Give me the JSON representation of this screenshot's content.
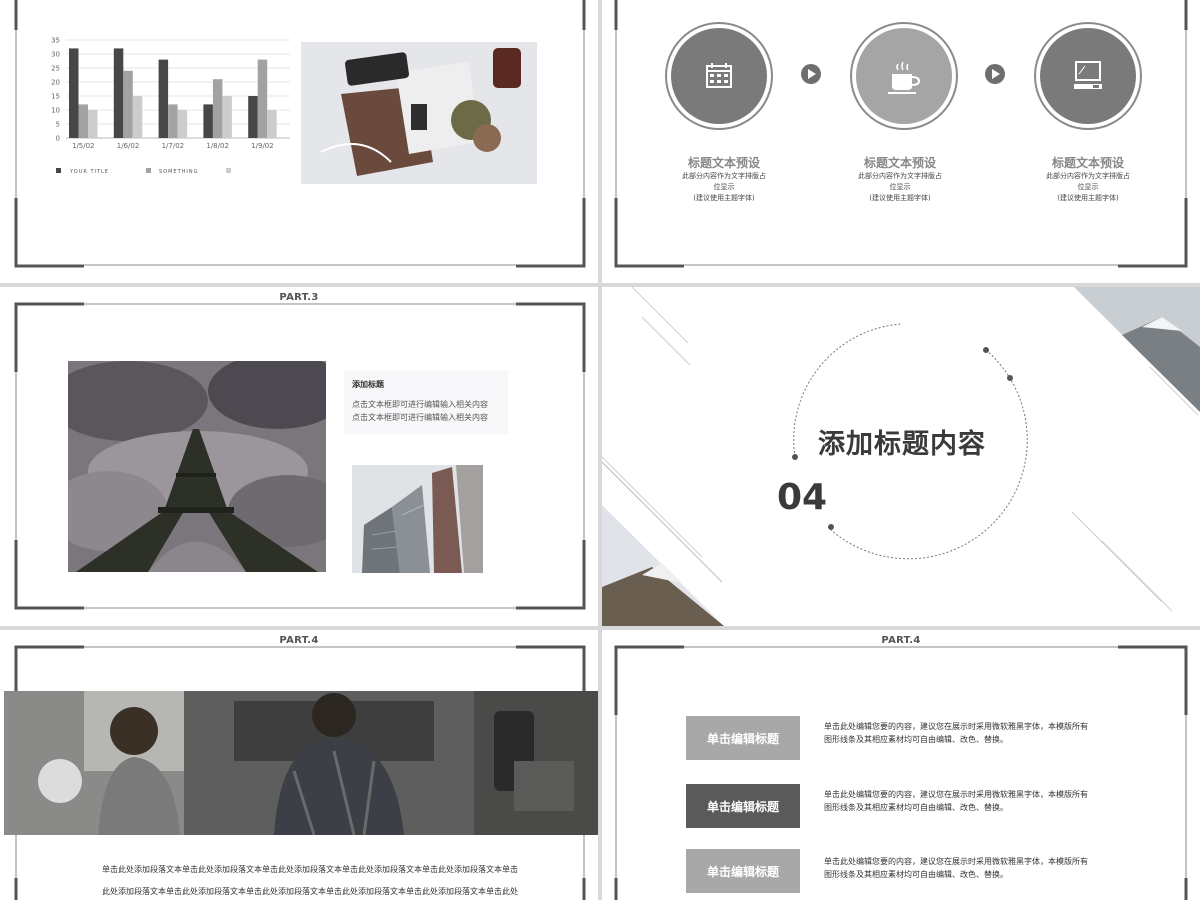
{
  "slide1": {
    "chart_data": {
      "type": "bar",
      "categories": [
        "1/5/02",
        "1/6/02",
        "1/7/02",
        "1/8/02",
        "1/9/02"
      ],
      "series": [
        {
          "name": "YOUR TITLE",
          "values": [
            32,
            32,
            28,
            12,
            15
          ],
          "color": "#474747"
        },
        {
          "name": "SOMETHING",
          "values": [
            12,
            24,
            12,
            21,
            28
          ],
          "color": "#a2a2a2"
        },
        {
          "values": [
            10,
            15,
            10,
            15,
            10
          ],
          "color": "#cccccc"
        }
      ],
      "yticks": [
        "0",
        "5",
        "10",
        "15",
        "20",
        "25",
        "30",
        "35"
      ],
      "ylim": [
        0,
        35
      ],
      "legend": "bottom-left",
      "grid": true
    },
    "legend": {
      "item1": "YOUR TITLE",
      "item2": "SOMETHING"
    },
    "photo_icon": "desk-flatlay-photo"
  },
  "slide2": {
    "steps": [
      {
        "icon": "calendar-icon",
        "title": "标题文本预设",
        "desc1": "此部分内容作为文字排版占",
        "desc2": "位显示",
        "desc3": "(建议使用主题字体)"
      },
      {
        "icon": "coffee-cup-icon",
        "title": "标题文本预设",
        "desc1": "此部分内容作为文字排版占",
        "desc2": "位显示",
        "desc3": "(建议使用主题字体)"
      },
      {
        "icon": "computer-icon",
        "title": "标题文本预设",
        "desc1": "此部分内容作为文字排版占",
        "desc2": "位显示",
        "desc3": "(建议使用主题字体)"
      }
    ],
    "colors": {
      "circle_dark": "#7a7a7a",
      "circle_light": "#a5a5a5"
    }
  },
  "slide3": {
    "part": "PART.3",
    "card_title": "添加标题",
    "card_line1": "点击文本框即可进行编辑输入相关内容",
    "card_line2": "点击文本框即可进行编辑输入相关内容"
  },
  "slide4": {
    "title": "添加标题内容",
    "number": "04"
  },
  "slide5": {
    "part": "PART.4",
    "para1": "单击此处添加段落文本单击此处添加段落文本单击此处添加段落文本单击此处添加段落文本单击此处添加段落文本单击",
    "para2": "此处添加段落文本单击此处添加段落文本单击此处添加段落文本单击此处添加段落文本单击此处添加段落文本单击此处"
  },
  "slide6": {
    "part": "PART.4",
    "items": [
      {
        "label": "单击编辑标题",
        "line1": "单击此处编辑您要的内容，建议您在展示时采用微软雅黑字体，本模版所有",
        "line2": "图形线条及其相应素材均可自由编辑、改色、替换。",
        "color": "#a8a8a8"
      },
      {
        "label": "单击编辑标题",
        "line1": "单击此处编辑您要的内容，建议您在展示时采用微软雅黑字体，本模版所有",
        "line2": "图形线条及其相应素材均可自由编辑、改色、替换。",
        "color": "#5a5a5a"
      },
      {
        "label": "单击编辑标题",
        "line1": "单击此处编辑您要的内容，建议您在展示时采用微软雅黑字体，本模版所有",
        "line2": "图形线条及其相应素材均可自由编辑、改色、替换。",
        "color": "#a8a8a8"
      }
    ]
  }
}
